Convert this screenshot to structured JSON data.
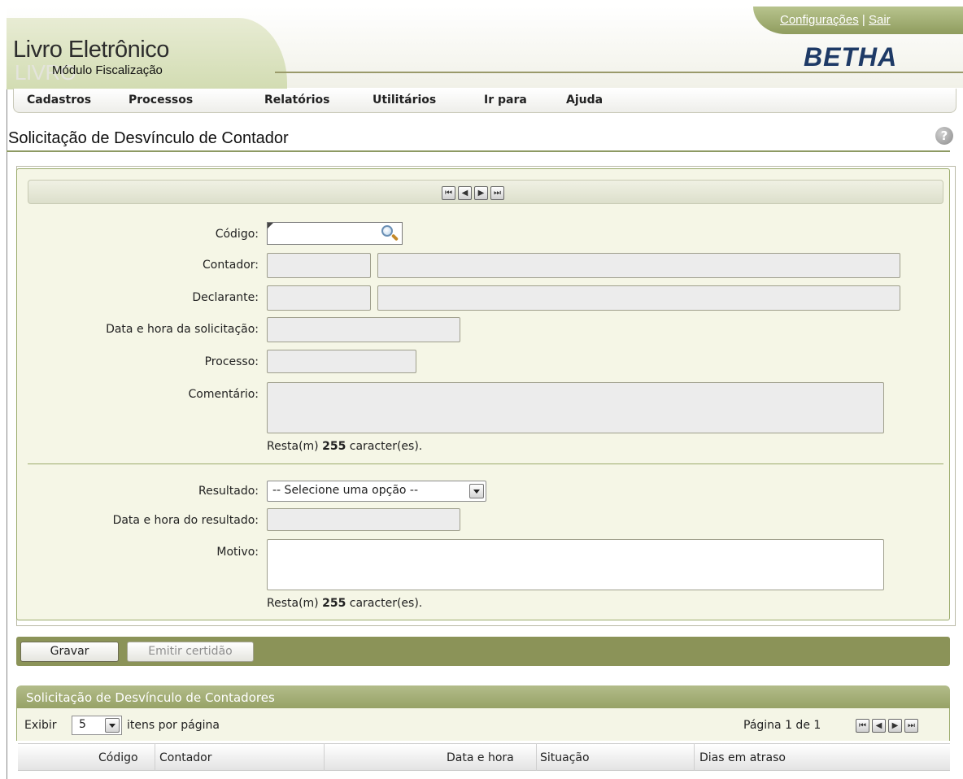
{
  "header": {
    "app_title": "Livro Eletrônico",
    "app_subtitle": "Módulo Fiscalização",
    "brand": "BETHA",
    "links": {
      "config": "Configurações",
      "separator": "|",
      "exit": "Sair"
    }
  },
  "menu": [
    "Cadastros",
    "Processos",
    "Relatórios",
    "Utilitários",
    "Ir para",
    "Ajuda"
  ],
  "page": {
    "title": "Solicitação de Desvínculo de Contador",
    "help_glyph": "?"
  },
  "form": {
    "nav_glyphs": [
      "⏮",
      "◀",
      "▶",
      "⏭"
    ],
    "labels": {
      "codigo": "Código:",
      "contador": "Contador:",
      "declarante": "Declarante:",
      "data_solicitacao": "Data e hora da solicitação:",
      "processo": "Processo:",
      "comentario": "Comentário:",
      "resultado": "Resultado:",
      "data_resultado": "Data e hora do resultado:",
      "motivo": "Motivo:"
    },
    "counter_prefix": "Resta(m)",
    "counter_value": "255",
    "counter_suffix": "caracter(es).",
    "resultado_selected": "-- Selecione uma opção --"
  },
  "buttons": {
    "save": "Gravar",
    "certificate": "Emitir certidão"
  },
  "grid": {
    "title": "Solicitação de Desvínculo de Contadores",
    "show_label": "Exibir",
    "per_page_value": "5",
    "per_page_suffix": "itens por página",
    "page_info": "Página 1 de 1",
    "columns": [
      "Código",
      "Contador",
      "Data e hora",
      "Situação",
      "Dias em atraso"
    ]
  },
  "colors": {
    "accent": "#8b9358",
    "panel": "#f5f6e6",
    "brand": "#1e3a66"
  }
}
